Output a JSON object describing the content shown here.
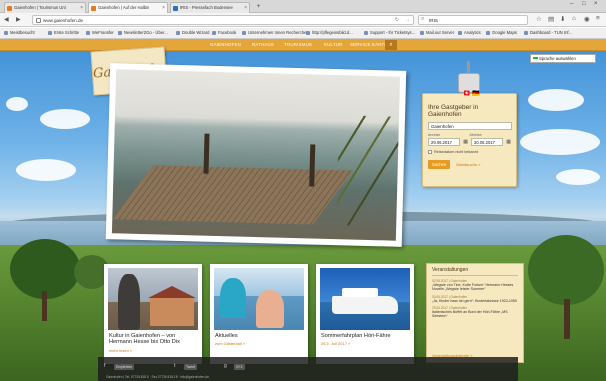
{
  "browser": {
    "tabs": [
      {
        "label": "Gaienhofen | Tourismus Unt"
      },
      {
        "label": "Gaienhofen | Auf der Halbin"
      },
      {
        "label": "IRIS - Pressefach Bodensee"
      }
    ],
    "new_tab": "+",
    "url": "www.gaienhofen.de",
    "search_text": "IRIS",
    "bookmarks": [
      {
        "label": "Meistbesucht"
      },
      {
        "label": "Erste Schritte"
      },
      {
        "label": "WeFransfer"
      },
      {
        "label": "Newsletter2Go - Über..."
      },
      {
        "label": "Double Wizard"
      },
      {
        "label": "Facebook"
      },
      {
        "label": "Unternehmen Innen Recherche..."
      },
      {
        "label": "http://pflegeinsbild.d..."
      },
      {
        "label": "Support - Ihr Ticketsys..."
      },
      {
        "label": "Mail.out Server"
      },
      {
        "label": "Analytics"
      },
      {
        "label": "Google Maps"
      },
      {
        "label": "Dashboard - TUN Inf..."
      }
    ]
  },
  "site": {
    "logo": "Gaienhofen",
    "menu": [
      {
        "label": "GAIENHOFEN"
      },
      {
        "label": "RATHAUS"
      },
      {
        "label": "TOURISMUS"
      },
      {
        "label": "KULTUR"
      },
      {
        "label": "SERVICE"
      },
      {
        "label": "KARTE"
      }
    ],
    "language": "Sprache auswählen",
    "host_box": {
      "title": "Ihre Gastgeber in Gaienhofen",
      "city": "Gaienhofen",
      "arrival_label": "Anreise",
      "departure_label": "Abreise",
      "arrival": "29.06.2017",
      "departure": "30.06.2017",
      "flexible_label": "Reisedatum nicht bekannt",
      "search_button": "Suchen",
      "advanced_link": "Detailsuche »"
    },
    "cards": [
      {
        "title": "Kultur in Gaienhofen – von Hermann Hesse bis Otto Dix",
        "more": "mehr lesen »"
      },
      {
        "title": "Aktuelles",
        "more": "zum Gästeblatt »"
      },
      {
        "title": "Sommerfahrplan Höri-Fähre",
        "more": "26.5. Juli 2017 »"
      }
    ],
    "events": {
      "title": "Veranstaltungen",
      "items": [
        {
          "date": "02.06.2017 | Gaienhofen",
          "text": "„Wegwie von Tine, Kotte Fortum“ Hermann Hesses Novelle „Wegwie letzter Sommer“"
        },
        {
          "date": "30.06.2017 | Gaienhofen",
          "text": "„Ja, Kinder hass ich gern“: Kindertabnisse 1923-1959"
        },
        {
          "date": "29.06.2017 | Gaienhofen",
          "text": "Italienisches Buffet an Bord der Höri-Fähre „MS Seestern“"
        }
      ],
      "all_link": "Veranstaltungskalender »"
    },
    "footer": {
      "buttons": [
        {
          "label": "Empfehlen"
        },
        {
          "label": "Tweet"
        },
        {
          "label": "G+1"
        }
      ],
      "line": "Gaienhofen | Tel. 07735 818-0 · Fax 07735 818-18 · info@gaienhofen.de"
    }
  }
}
